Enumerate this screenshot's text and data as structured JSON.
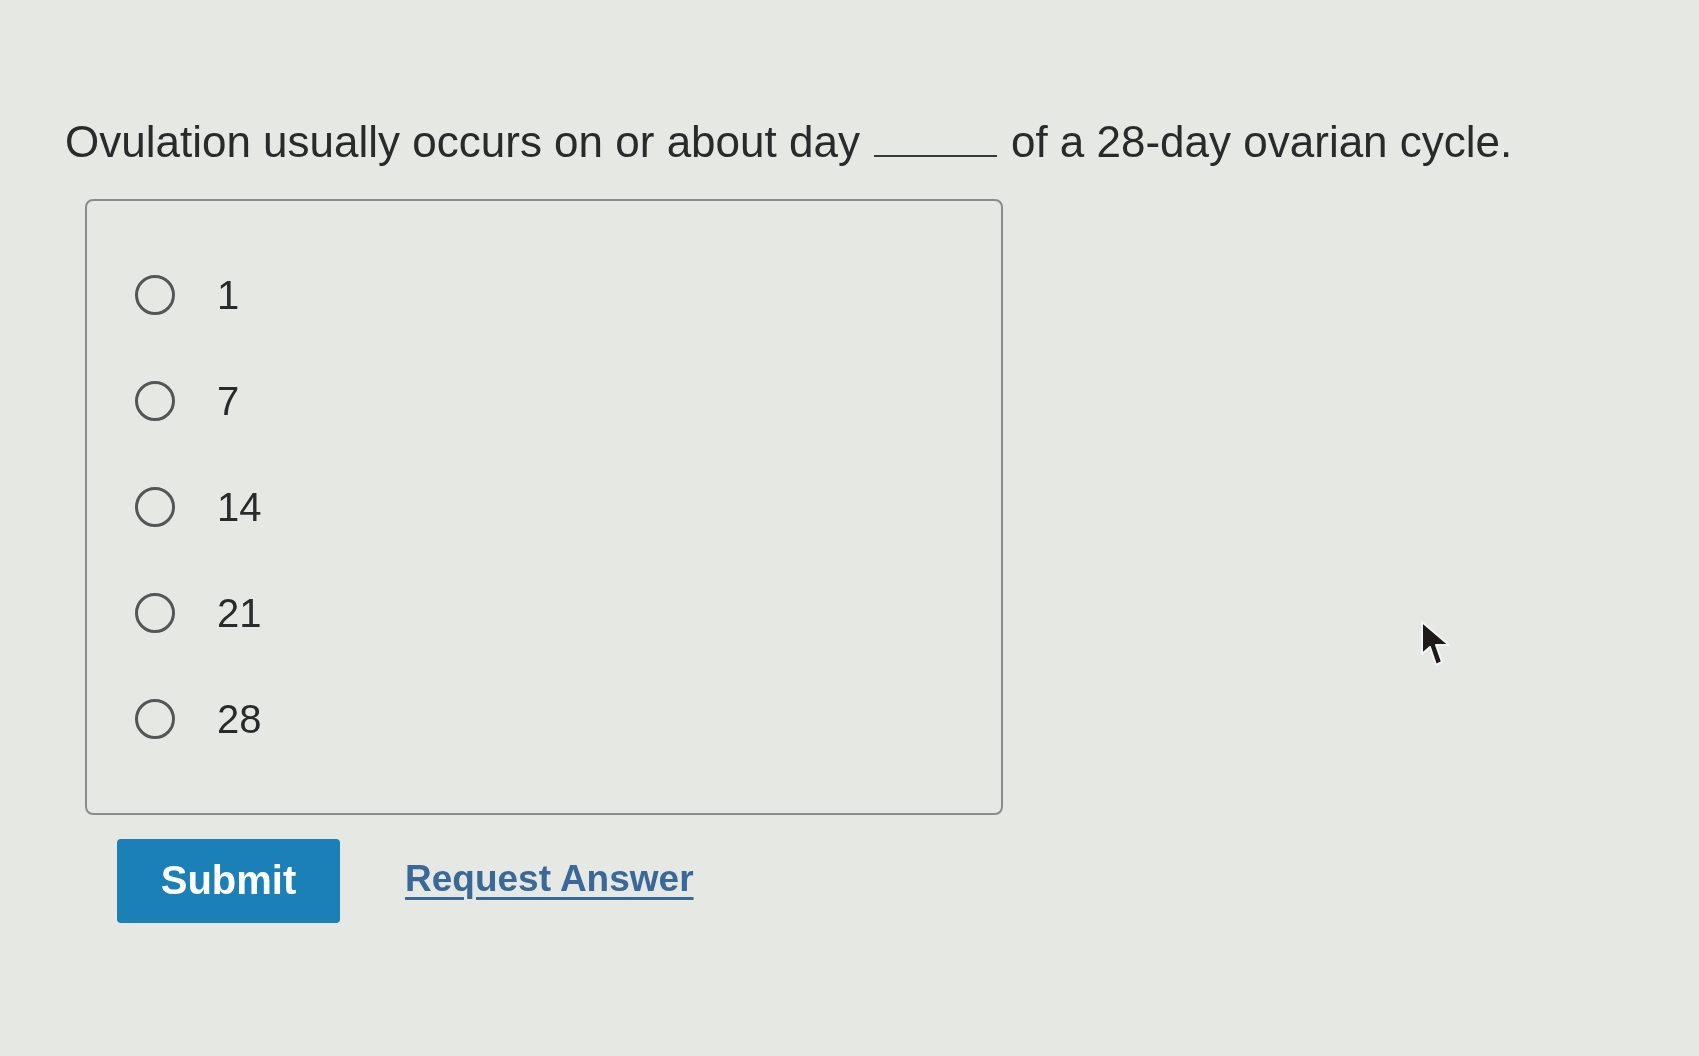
{
  "question": {
    "parts": [
      {
        "kind": "text",
        "text": "Ovulation usually occurs on or about day"
      },
      {
        "kind": "blank"
      },
      {
        "kind": "text",
        "text": "of a 28-day ovarian cycle."
      }
    ]
  },
  "options": [
    {
      "label": "1",
      "selected": false
    },
    {
      "label": "7",
      "selected": false
    },
    {
      "label": "14",
      "selected": false
    },
    {
      "label": "21",
      "selected": false
    },
    {
      "label": "28",
      "selected": false
    }
  ],
  "actions": [
    {
      "kind": "button",
      "label": "Submit"
    },
    {
      "kind": "link",
      "label": "Request Answer"
    }
  ],
  "pointer": {
    "kind": "arrow"
  }
}
